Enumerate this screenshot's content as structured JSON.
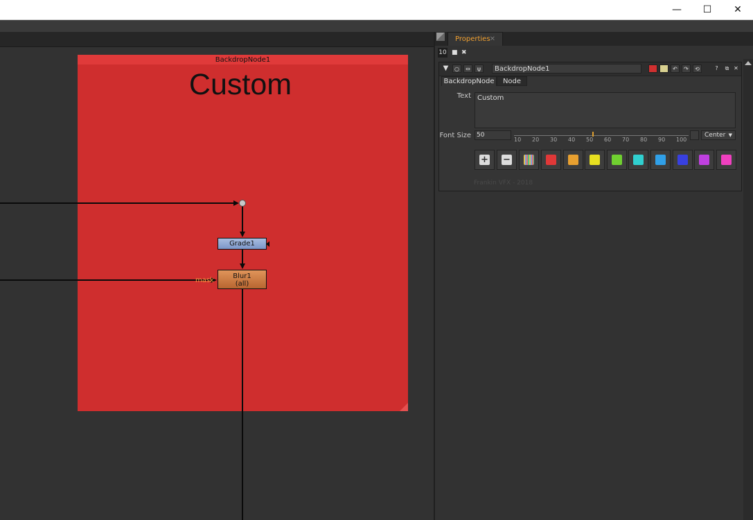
{
  "window": {
    "minimize": "—",
    "maximize": "☐",
    "close": "✕"
  },
  "dag": {
    "backdrop": {
      "title": "BackdropNode1",
      "text": "Custom",
      "color": "#cf2e2e"
    },
    "nodes": {
      "grade": "Grade1",
      "blur_name": "Blur1",
      "blur_channels": "(all)",
      "mask_input": "mask"
    }
  },
  "properties": {
    "tab_label": "Properties",
    "tab_close": "✕",
    "max_panels": "10",
    "node_name": "BackdropNode1",
    "tabs": [
      "BackdropNode",
      "Node"
    ],
    "text_label": "Text",
    "text_value": "Custom",
    "font_size_label": "Font Size",
    "font_size_value": "50",
    "font_size_fraction": 0.45,
    "slider_ticks": [
      "10",
      "20",
      "30",
      "40",
      "50",
      "60",
      "70",
      "80",
      "90",
      "100"
    ],
    "align_value": "Center",
    "color_swatches": [
      "#e03838",
      "#e8a030",
      "#e8e020",
      "#70d030",
      "#30d0d0",
      "#30a0e8",
      "#3840e0",
      "#c040e0",
      "#f040c0"
    ],
    "credit": "Frankin VFX - 2018"
  }
}
